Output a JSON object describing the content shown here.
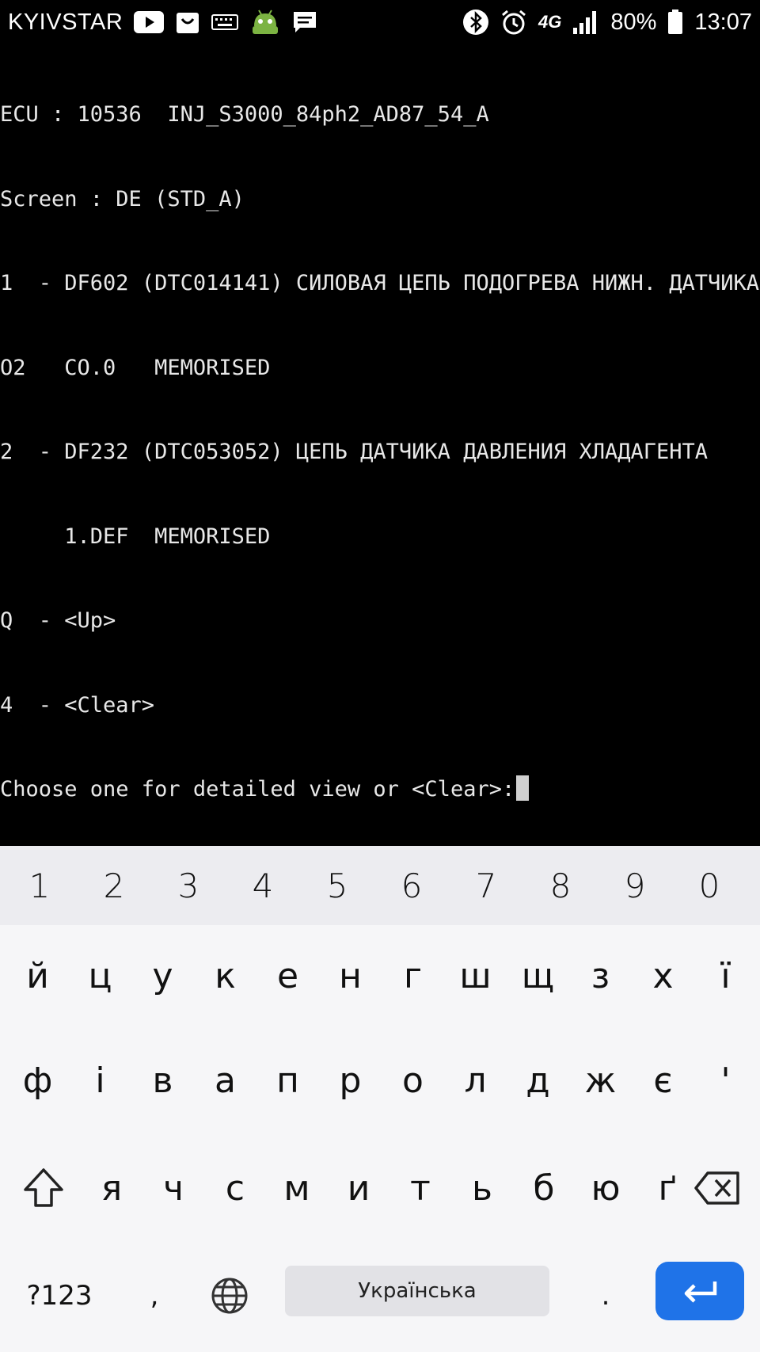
{
  "status_bar": {
    "carrier": "KYIVSTAR",
    "network": "4G",
    "battery": "80%",
    "time": "13:07"
  },
  "terminal": {
    "lines": [
      "ECU : 10536  INJ_S3000_84ph2_AD87_54_A",
      "Screen : DE (STD_A)",
      "1  - DF602 (DTC014141) СИЛОВАЯ ЦЕПЬ ПОДОГРЕВА НИЖН. ДАТЧИКА",
      "O2   CO.0   MEMORISED",
      "2  - DF232 (DTC053052) ЦЕПЬ ДАТЧИКА ДАВЛЕНИЯ ХЛАДАГЕНТА",
      "     1.DEF  MEMORISED",
      "Q  - <Up>",
      "4  - <Clear>",
      "Choose one for detailed view or <Clear>:"
    ]
  },
  "keyboard": {
    "numbers": [
      "1",
      "2",
      "3",
      "4",
      "5",
      "6",
      "7",
      "8",
      "9",
      "0"
    ],
    "row1": [
      "й",
      "ц",
      "у",
      "к",
      "е",
      "н",
      "г",
      "ш",
      "щ",
      "з",
      "х",
      "ї"
    ],
    "row2": [
      "ф",
      "і",
      "в",
      "а",
      "п",
      "р",
      "о",
      "л",
      "д",
      "ж",
      "є",
      "'"
    ],
    "row3": [
      "я",
      "ч",
      "с",
      "м",
      "и",
      "т",
      "ь",
      "б",
      "ю",
      "ґ"
    ],
    "symbols_label": "?123",
    "comma": ",",
    "space_label": "Українська",
    "period": "."
  },
  "colors": {
    "enter": "#1f73e8",
    "terminal_text": "#e8e8e8"
  }
}
